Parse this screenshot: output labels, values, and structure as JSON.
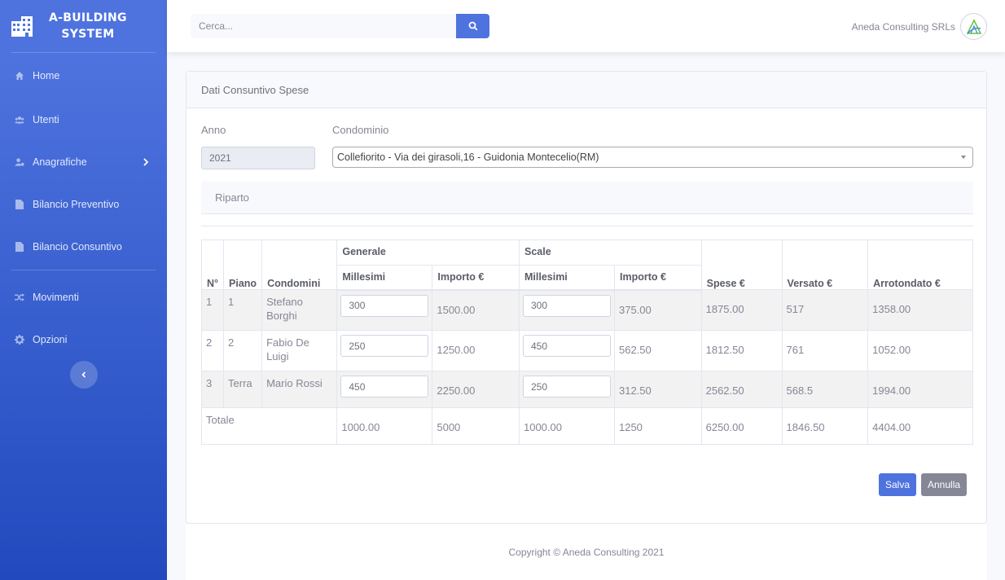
{
  "brand": {
    "line1": "A-BUILDING",
    "line2": "SYSTEM"
  },
  "sidebar": {
    "items": [
      {
        "label": "Home",
        "icon": "home-icon"
      },
      {
        "label": "Utenti",
        "icon": "users-icon"
      },
      {
        "label": "Anagrafiche",
        "icon": "user-cog-icon"
      },
      {
        "label": "Bilancio Preventivo",
        "icon": "file-icon"
      },
      {
        "label": "Bilancio Consuntivo",
        "icon": "file-icon"
      },
      {
        "label": "Movimenti",
        "icon": "random-icon"
      },
      {
        "label": "Opzioni",
        "icon": "gear-icon"
      }
    ]
  },
  "topbar": {
    "search_placeholder": "Cerca...",
    "user_name": "Aneda Consulting SRLs"
  },
  "card": {
    "title": "Dati Consuntivo Spese",
    "anno_label": "Anno",
    "anno_value": "2021",
    "condominio_label": "Condominio",
    "condominio_value": "Collefiorito - Via dei girasoli,16 - Guidonia Montecelio(RM)",
    "riparto_label": "Riparto"
  },
  "table": {
    "group_generale": "Generale",
    "group_scale": "Scale",
    "headers": [
      "N°",
      "Piano",
      "Condomini",
      "Millesimi",
      "Importo €",
      "Millesimi",
      "Importo €",
      "Spese €",
      "Versato €",
      "Arrotondato €"
    ],
    "rows": [
      {
        "n": "1",
        "piano": "1",
        "condomini": "Stefano Borghi",
        "gen_millesimi": "300",
        "gen_importo": "1500.00",
        "scale_millesimi": "300",
        "scale_importo": "375.00",
        "spese": "1875.00",
        "versato": "517",
        "arrotondato": "1358.00"
      },
      {
        "n": "2",
        "piano": "2",
        "condomini": "Fabio De Luigi",
        "gen_millesimi": "250",
        "gen_importo": "1250.00",
        "scale_millesimi": "450",
        "scale_importo": "562.50",
        "spese": "1812.50",
        "versato": "761",
        "arrotondato": "1052.00"
      },
      {
        "n": "3",
        "piano": "Terra",
        "condomini": "Mario Rossi",
        "gen_millesimi": "450",
        "gen_importo": "2250.00",
        "scale_millesimi": "250",
        "scale_importo": "312.50",
        "spese": "2562.50",
        "versato": "568.5",
        "arrotondato": "1994.00"
      }
    ],
    "totale": {
      "label": "Totale",
      "gen_millesimi": "1000.00",
      "gen_importo": "5000",
      "scale_millesimi": "1000.00",
      "scale_importo": "1250",
      "spese": "6250.00",
      "versato": "1846.50",
      "arrotondato": "4404.00"
    }
  },
  "buttons": {
    "salva": "Salva",
    "annulla": "Annulla"
  },
  "footer": {
    "copyright": "Copyright © Aneda Consulting 2021"
  },
  "colors": {
    "primary": "#4e73df",
    "sidebar_end": "#224abe",
    "secondary": "#858796"
  }
}
